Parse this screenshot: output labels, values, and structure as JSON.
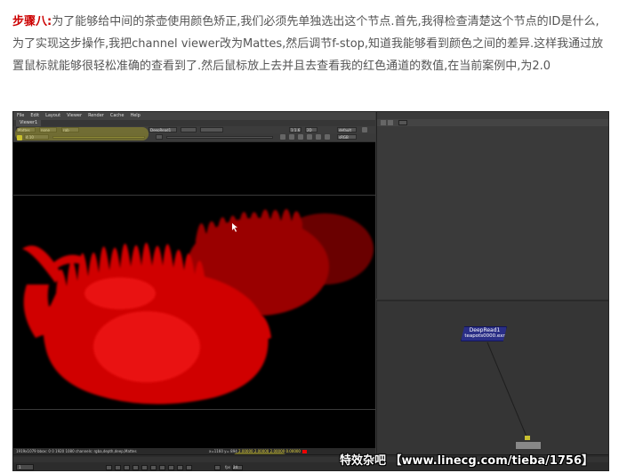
{
  "article": {
    "step_label": "步骤八:",
    "body": "为了能够给中间的茶壶使用颜色矫正,我们必须先单独选出这个节点.首先,我得检查清楚这个节点的ID是什么,为了实现这步操作,我把channel viewer改为Mattes,然后调节f-stop,知道我能够看到颜色之间的差异.这样我通过放置鼠标就能够很轻松准确的查看到了.然后鼠标放上去并且去查看我的红色通道的数值,在当前案例中,为2.0"
  },
  "app": {
    "menu": [
      "File",
      "Edit",
      "Layout",
      "Viewer",
      "Render",
      "Cache",
      "Help"
    ],
    "viewer_tab": "Viewer1",
    "channel_set": "Mattes",
    "channel_layer": "none",
    "channel_rgb": "rgb",
    "input_a": "DeepRead1",
    "zoom": "1:1.6",
    "view_mode": "2D",
    "lut": "default",
    "fstop_value": "4.10",
    "colorspace": "sRGB",
    "info_bar": "1919x1079 bbox: 0 0 1920 1080 channels: rgba,depth,deep,Mattes",
    "cursor_coords": "x=1160 y= 894",
    "pixel_values": "2.00000  2.00000  2.00000  0.00000",
    "frame": "1",
    "fps_label": "fps",
    "fps_value": "24"
  },
  "node_graph": {
    "node_title": "DeepRead1",
    "node_file": "teapots0000.exr",
    "node_color": "#2a2e86",
    "viewer_node_label": "Viewer1"
  },
  "colors": {
    "matte_red": "#e00000",
    "highlight": "#c8be28"
  },
  "watermark": "特效杂吧 【www.linecg.com/tieba/1756】"
}
